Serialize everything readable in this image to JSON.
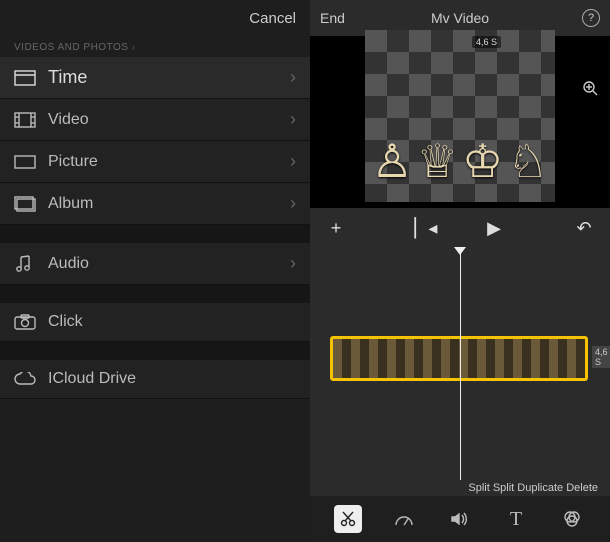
{
  "left": {
    "cancel": "Cancel",
    "section": "Videos and Photos",
    "items": [
      {
        "label": "Time",
        "icon": "moments-icon",
        "chevron": true,
        "highlighted": true
      },
      {
        "label": "Video",
        "icon": "video-icon",
        "chevron": true
      },
      {
        "label": "Picture",
        "icon": "photo-icon",
        "chevron": true
      },
      {
        "label": "Album",
        "icon": "album-icon",
        "chevron": true
      }
    ],
    "audio": {
      "label": "Audio",
      "icon": "audio-icon",
      "chevron": true
    },
    "camera": {
      "label": "Click",
      "icon": "camera-icon"
    },
    "icloud": {
      "label": "ICloud Drive",
      "icon": "cloud-icon"
    }
  },
  "right": {
    "end": "End",
    "title": "Mv Video",
    "preview_duration": "4,6 S",
    "clip_duration": "4,6 S",
    "edit_actions": "Split Split Duplicate Delete",
    "tools": [
      "cut",
      "speed",
      "volume",
      "text",
      "filter"
    ]
  }
}
